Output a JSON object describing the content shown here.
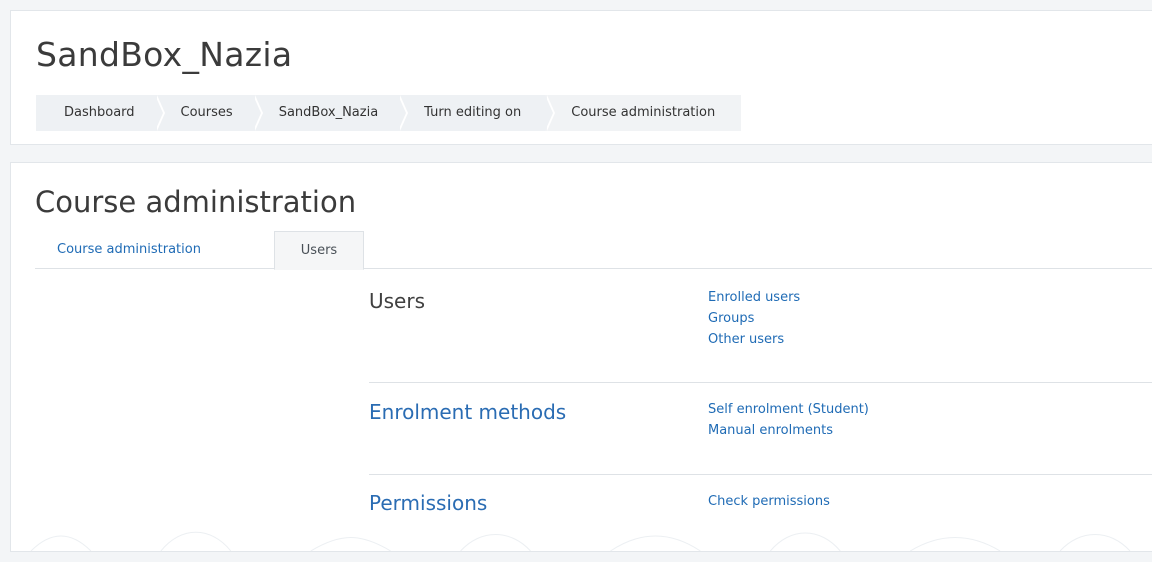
{
  "header": {
    "course_title": "SandBox_Nazia",
    "breadcrumb": [
      {
        "label": "Dashboard"
      },
      {
        "label": "Courses"
      },
      {
        "label": "SandBox_Nazia"
      },
      {
        "label": "Turn editing on"
      },
      {
        "label": "Course administration"
      }
    ]
  },
  "main": {
    "page_heading": "Course administration",
    "tabs": [
      {
        "label": "Course administration",
        "active": false
      },
      {
        "label": "Users",
        "active": true
      }
    ],
    "sections": [
      {
        "heading": "Users",
        "links": [
          "Enrolled users",
          "Groups",
          "Other users"
        ]
      },
      {
        "heading": "Enrolment methods",
        "links": [
          "Self enrolment (Student)",
          "Manual enrolments"
        ]
      },
      {
        "heading": "Permissions",
        "links": [
          "Check permissions"
        ]
      }
    ]
  },
  "colors": {
    "link": "#1f6bb5",
    "breadcrumb_bg": "#eef1f4",
    "page_bg": "#f3f5f7"
  }
}
